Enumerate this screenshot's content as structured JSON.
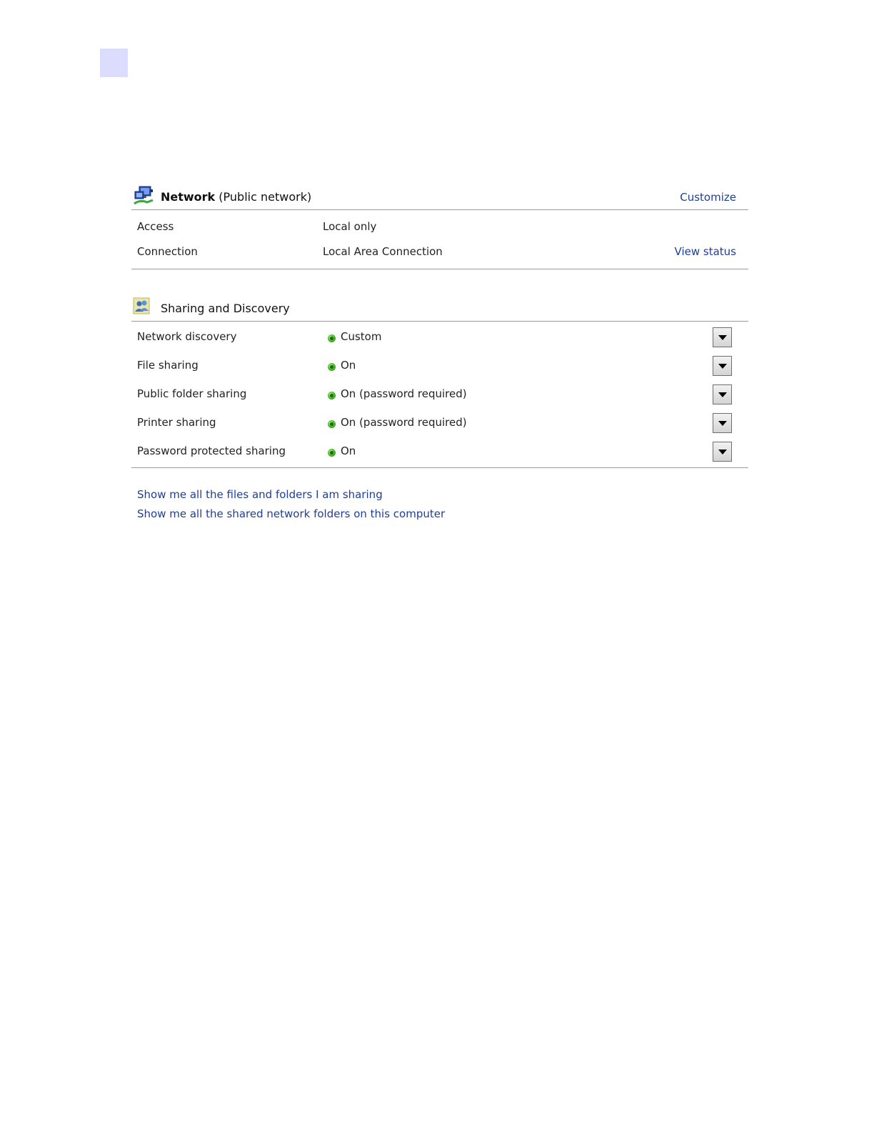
{
  "network": {
    "name": "Network",
    "type": "(Public network)",
    "customize_link": "Customize",
    "rows": [
      {
        "label": "Access",
        "value": "Local only",
        "link": ""
      },
      {
        "label": "Connection",
        "value": "Local Area Connection",
        "link": "View status"
      }
    ]
  },
  "sharing": {
    "title": "Sharing and Discovery",
    "rows": [
      {
        "label": "Network discovery",
        "value": "Custom"
      },
      {
        "label": "File sharing",
        "value": "On"
      },
      {
        "label": "Public folder sharing",
        "value": "On (password required)"
      },
      {
        "label": "Printer sharing",
        "value": "On (password required)"
      },
      {
        "label": "Password protected sharing",
        "value": "On"
      }
    ]
  },
  "links": {
    "files_folders": "Show me all the files and folders I am sharing",
    "shared_folders": "Show me all the shared network folders on this computer"
  },
  "icons": {
    "network": "network-computers-icon",
    "sharing": "sharing-users-icon",
    "status": "green-status-dot-icon",
    "dropdown": "chevron-down-icon"
  },
  "colors": {
    "link": "#1e3f96",
    "status_on": "#4fbf2f",
    "accent_square": "#dcdcff"
  }
}
